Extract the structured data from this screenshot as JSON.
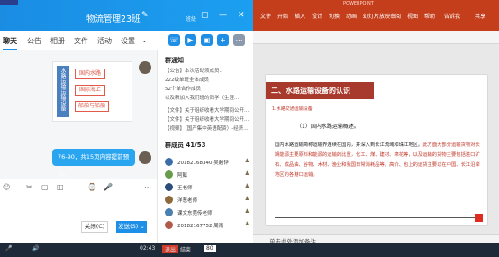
{
  "qq": {
    "top_tag": "",
    "title": "物流管理23班",
    "edit_icon": "edit-icon",
    "group_flag": "班级",
    "window_controls": [
      "▢",
      "—",
      "✕"
    ],
    "tabs": [
      "聊天",
      "公告",
      "相册",
      "文件",
      "活动",
      "设置"
    ],
    "tab_more": "⌄",
    "chat": {
      "slide_vertical_text": "水路运输运输设备",
      "pills": [
        "国内水路",
        "国际海上",
        "船舶与船舶"
      ],
      "message": "76-90，共15页内容提前预习。"
    },
    "toolbar_icons": [
      "☺",
      "✂",
      "▢",
      "◫",
      "⌚",
      "🎤",
      "⋯"
    ],
    "close_label": "关闭(C)",
    "send_label": "发送(S)",
    "send_arrow": "⌄",
    "notice_title": "群通知",
    "notice_lines": [
      "【公告】本次活动须成员：",
      "222级单班全体成员",
      "52个单合作成员",
      "以及新加入我们班的同学（生涯...",
      "【文件】关于组织收看大学期间公开...",
      "【文件】关于组织收看大学期间公开...",
      "【视频】（国产集中英语配资）-经济..."
    ],
    "member_count": "群成员 41/53",
    "members": [
      {
        "name": "20182168340 吴越铧",
        "color": "#3b6ea8",
        "flag": "♟"
      },
      {
        "name": "阿懿",
        "color": "#6a9a4c",
        "flag": "♟"
      },
      {
        "name": "王老师",
        "color": "#2c4c7c",
        "flag": "♟"
      },
      {
        "name": "洋葱老师",
        "color": "#8c6a3e",
        "flag": "♟"
      },
      {
        "name": "课文东莞传老师",
        "color": "#4a7fb0",
        "flag": "♟"
      },
      {
        "name": "20182167752 周雨",
        "color": "#b05a4a",
        "flag": "♟"
      }
    ]
  },
  "ppt": {
    "titlebar_text": "POWERPOINT",
    "tabs": [
      "文件",
      "开始",
      "插入",
      "设计",
      "切换",
      "动画",
      "幻灯片放映",
      "审阅",
      "视图",
      "帮助",
      "告诉我",
      "共享"
    ],
    "slide": {
      "banner": "二、水路运输设备的认识",
      "subtitle": "1.水路交通运输设备",
      "heading": "（1）国内水路运输概述。",
      "body_lead": "国内水路运输简称运输界连续在国内，并深入到长江流域和珠江地区。",
      "body_rest": "此方面大部分运输货物对长期能源主要原料和能源的运输的比重，化工、煤、建材、棉花等，以及运输的货物主要包括进口矿石、成品油、谷物、木材、渔业和我国日常消耗品等。高价、也上的运货主要以在中国、长江沿岸地区的各港口运输。"
    },
    "notes": "单击此处添加备注"
  },
  "taskbar": {
    "items": [
      "02:43",
      "退出",
      "结束",
      "80"
    ]
  }
}
